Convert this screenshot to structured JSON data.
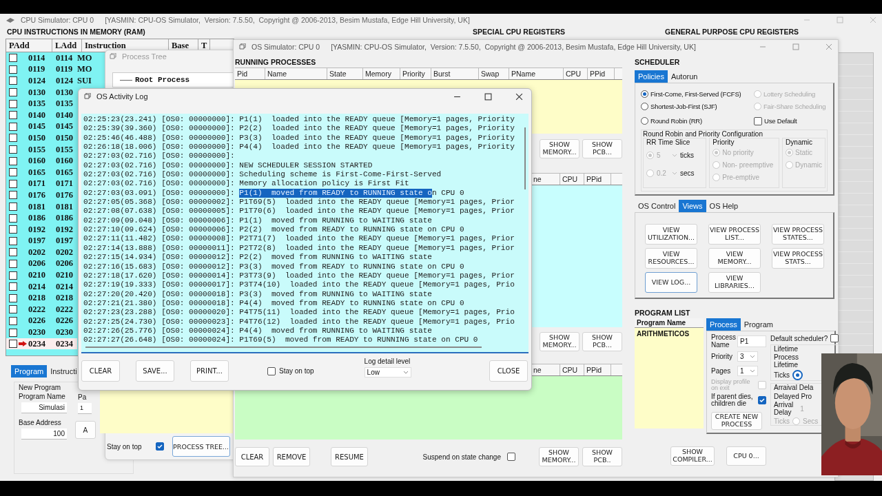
{
  "cpu_window": {
    "title": "CPU Simulator: CPU 0",
    "subtitle": "[YASMIN: CPU-OS Simulator,  Version: 7.5.50,  Copyright @ 2006-2013, Besim Mustafa, Edge Hill University, UK]",
    "ram_heading": "CPU INSTRUCTIONS IN MEMORY (RAM)",
    "special_heading": "SPECIAL CPU REGISTERS",
    "general_heading": "GENERAL PURPOSE CPU REGISTERS",
    "columns": [
      "PAdd",
      "LAdd",
      "Instruction",
      "Base",
      "T"
    ],
    "rows": [
      {
        "padd": "0114",
        "ladd": "0114",
        "instruction": "MO",
        "checked": false,
        "current": false
      },
      {
        "padd": "0119",
        "ladd": "0119",
        "instruction": "MO",
        "checked": false,
        "current": false
      },
      {
        "padd": "0124",
        "ladd": "0124",
        "instruction": "SUI",
        "checked": false,
        "current": false
      },
      {
        "padd": "0130",
        "ladd": "0130",
        "checked": false,
        "current": false
      },
      {
        "padd": "0135",
        "ladd": "0135",
        "checked": false,
        "current": false
      },
      {
        "padd": "0140",
        "ladd": "0140",
        "checked": false,
        "current": false
      },
      {
        "padd": "0145",
        "ladd": "0145",
        "checked": false,
        "current": false
      },
      {
        "padd": "0150",
        "ladd": "0150",
        "checked": false,
        "current": false
      },
      {
        "padd": "0155",
        "ladd": "0155",
        "checked": false,
        "current": false
      },
      {
        "padd": "0160",
        "ladd": "0160",
        "checked": false,
        "current": false
      },
      {
        "padd": "0165",
        "ladd": "0165",
        "checked": false,
        "current": false
      },
      {
        "padd": "0171",
        "ladd": "0171",
        "checked": false,
        "current": false
      },
      {
        "padd": "0176",
        "ladd": "0176",
        "checked": false,
        "current": false
      },
      {
        "padd": "0181",
        "ladd": "0181",
        "checked": false,
        "current": false
      },
      {
        "padd": "0186",
        "ladd": "0186",
        "checked": false,
        "current": false
      },
      {
        "padd": "0192",
        "ladd": "0192",
        "checked": false,
        "current": false
      },
      {
        "padd": "0197",
        "ladd": "0197",
        "checked": false,
        "current": false
      },
      {
        "padd": "0202",
        "ladd": "0202",
        "checked": false,
        "current": false
      },
      {
        "padd": "0206",
        "ladd": "0206",
        "checked": false,
        "current": false
      },
      {
        "padd": "0210",
        "ladd": "0210",
        "checked": false,
        "current": false
      },
      {
        "padd": "0214",
        "ladd": "0214",
        "checked": false,
        "current": false
      },
      {
        "padd": "0218",
        "ladd": "0218",
        "checked": false,
        "current": false
      },
      {
        "padd": "0222",
        "ladd": "0222",
        "checked": false,
        "current": false
      },
      {
        "padd": "0226",
        "ladd": "0226",
        "checked": false,
        "current": false
      },
      {
        "padd": "0230",
        "ladd": "0230",
        "checked": false,
        "current": false
      },
      {
        "padd": "0234",
        "ladd": "0234",
        "checked": false,
        "current": true
      }
    ],
    "tabs": [
      {
        "label": "Program",
        "selected": true
      },
      {
        "label": "Instructi",
        "selected": false
      }
    ],
    "new_program": {
      "title": "New Program",
      "name_label": "Program Name",
      "name": "Simulasi",
      "pages_label": "Pa",
      "pages": "1",
      "base_label": "Base Address",
      "base": "100",
      "button": "A"
    }
  },
  "process_tree": {
    "title": "Process Tree",
    "root": "Root Process",
    "stay_on_top": {
      "label": "Stay on top",
      "checked": true
    },
    "button": "PROCESS TREE..."
  },
  "os_window": {
    "title": "OS Simulator: CPU 0",
    "subtitle": "[YASMIN: CPU-OS Simulator,  Version: 7.5.50,  Copyright @ 2006-2013, Besim Mustafa, Edge Hill University, UK]",
    "running_heading": "RUNNING PROCESSES",
    "running_columns": [
      "Pid",
      "Name",
      "State",
      "Memory",
      "Priority",
      "Burst",
      "Swap",
      "PName",
      "CPU",
      "PPid"
    ],
    "buttons_1": [
      "SHOW\nMEMORY...",
      "SHOW\nPCB..."
    ],
    "table_2_columns": [
      "ne",
      "CPU",
      "PPid"
    ],
    "buttons_2": [
      "SHOW\nMEMORY...",
      "SHOW\nPCB..."
    ],
    "table_3_columns": [
      "ne",
      "CPU",
      "PPid"
    ],
    "actions": [
      "CLEAR",
      "REMOVE",
      "RESUME"
    ],
    "suspend": {
      "label": "Suspend on state change",
      "checked": false
    },
    "buttons_3": [
      "SHOW\nMEMORY...",
      "SHOW\nPCB.."
    ]
  },
  "scheduler": {
    "heading": "SCHEDULER",
    "tabs": [
      {
        "label": "Policies",
        "selected": true
      },
      {
        "label": "Autorun",
        "selected": false
      }
    ],
    "policies": [
      {
        "label": "First-Come, First-Served (FCFS)",
        "selected": true,
        "disabled": false
      },
      {
        "label": "Shortest-Job-First (SJF)",
        "selected": false,
        "disabled": false
      },
      {
        "label": "Round Robin (RR)",
        "selected": false,
        "disabled": false
      },
      {
        "label": "Lottery Scheduling",
        "selected": false,
        "disabled": true
      },
      {
        "label": "Fair-Share Scheduling",
        "selected": false,
        "disabled": true
      }
    ],
    "use_default": {
      "label": "Use Default",
      "checked": false
    },
    "config_title": "Round Robin and Priority Configuration",
    "time_slice": {
      "title": "RR Time Slice",
      "options": [
        {
          "value": "5",
          "unit": "ticks",
          "selected": true
        },
        {
          "value": "0.2",
          "unit": "secs",
          "selected": false
        }
      ]
    },
    "priority": {
      "title": "Priority",
      "options": [
        {
          "label": "No priority",
          "selected": true
        },
        {
          "label": "Non- preemptive",
          "selected": false
        },
        {
          "label": "Pre-emptive",
          "selected": false
        }
      ]
    },
    "dynamic": {
      "title": "Dynamic",
      "options": [
        {
          "label": "Static",
          "selected": true
        },
        {
          "label": "Dynamic",
          "selected": false
        }
      ]
    }
  },
  "os_tabs": [
    {
      "label": "OS Control",
      "selected": false
    },
    {
      "label": "Views",
      "selected": true
    },
    {
      "label": "OS Help",
      "selected": false
    }
  ],
  "view_buttons": [
    {
      "label": "VIEW\nUTILIZATION...",
      "focused": false
    },
    {
      "label": "VIEW PROCESS\nLIST...",
      "focused": false
    },
    {
      "label": "VIEW PROCESS\nSTATES...",
      "focused": false
    },
    {
      "label": "VIEW\nRESOURCES...",
      "focused": false
    },
    {
      "label": "VIEW\nMEMORY...",
      "focused": false
    },
    {
      "label": "VIEW PROCESS\nSTATS...",
      "focused": false
    },
    {
      "label": "VIEW LOG...",
      "focused": true
    },
    {
      "label": "VIEW\nLIBRARIES...",
      "focused": false
    }
  ],
  "program_list": {
    "heading": "PROGRAM LIST",
    "column": "Program Name",
    "items": [
      "ARITHMETICOS"
    ]
  },
  "process_tabs": [
    {
      "label": "Process",
      "selected": true
    },
    {
      "label": "Program",
      "selected": false
    }
  ],
  "process_form": {
    "name_label": "Process\nName",
    "name": "P1",
    "default_scheduler": {
      "label": "Default scheduler?",
      "checked": false
    },
    "priority_label": "Priority",
    "priority": "3",
    "pages_label": "Pages",
    "pages": "1",
    "lifetime": {
      "title": "Lifetime",
      "label": "Process\nLifetime",
      "ticks_label": "Ticks",
      "ticks_selected": true
    },
    "display_profile": {
      "label": "Display profile\non exit",
      "checked": false,
      "disabled": true
    },
    "parent_dies": {
      "label": "If parent dies,\nchildren die",
      "checked": true,
      "disabled": false
    },
    "arrival": {
      "title": "Arraival Dela",
      "delayed": "Delayed Pro",
      "label": "Arrival\nDelay",
      "value": "1",
      "ticks": "Ticks",
      "secs": "Secs",
      "secs_selected": false
    },
    "create_button": "CREATE NEW\nPROCESS"
  },
  "bottom_buttons": [
    "SHOW\nCOMPILER...",
    "CPU 0..."
  ],
  "activity_log": {
    "title": "OS Activity Log",
    "lines": [
      {
        "text": "02:25:23(23.241) [OS0: 00000000]: P1(1)  loaded into the READY queue [Memory=1 pages, Priority"
      },
      {
        "text": "02:25:39(39.360) [OS0: 00000000]: P2(2)  loaded into the READY queue [Memory=1 pages, Priority"
      },
      {
        "text": "02:25:46(46.488) [OS0: 00000000]: P3(3)  loaded into the READY queue [Memory=1 pages, Priority"
      },
      {
        "text": "02:26:18(18.006) [OS0: 00000000]: P4(4)  loaded into the READY queue [Memory=1 pages, Priority"
      },
      {
        "text": "02:27:03(02.716) [OS0: 00000000]:"
      },
      {
        "text": "02:27:03(02.716) [OS0: 00000000]: NEW SCHEDULER SESSION STARTED"
      },
      {
        "text": "02:27:03(02.716) [OS0: 00000000]: Scheduling scheme is First-Come-First-Served"
      },
      {
        "text": "02:27:03(02.716) [OS0: 00000000]: Memory allocation policy is First Fit"
      },
      {
        "text": "02:27:03(03.091) [OS0: 00000000]: ",
        "selection": "P1(1)  moved from READY to RUNNING state o",
        "after": "n CPU 0"
      },
      {
        "text": "02:27:05(05.368) [OS0: 00000002]: P1T69(5)  loaded into the READY queue [Memory=1 pages, Prior"
      },
      {
        "text": "02:27:08(07.638) [OS0: 00000005]: P1T70(6)  loaded into the READY queue [Memory=1 pages, Prior"
      },
      {
        "text": "02:27:09(09.048) [OS0: 00000006]: P1(1)  moved from RUNNING to WAITING state"
      },
      {
        "text": "02:27:10(09.624) [OS0: 00000006]: P2(2)  moved from READY to RUNNING state on CPU 0"
      },
      {
        "text": "02:27:11(11.482) [OS0: 00000008]: P2T71(7)  loaded into the READY queue [Memory=1 pages, Prior"
      },
      {
        "text": "02:27:14(13.888) [OS0: 00000011]: P2T72(8)  loaded into the READY queue [Memory=1 pages, Prior"
      },
      {
        "text": "02:27:15(14.934) [OS0: 00000012]: P2(2)  moved from RUNNING to WAITING state"
      },
      {
        "text": "02:27:16(15.683) [OS0: 00000012]: P3(3)  moved from READY to RUNNING state on CPU 0"
      },
      {
        "text": "02:27:18(17.620) [OS0: 00000014]: P3T73(9)  loaded into the READY queue [Memory=1 pages, Prior"
      },
      {
        "text": "02:27:19(19.333) [OS0: 00000017]: P3T74(10)  loaded into the READY queue [Memory=1 pages, Prio"
      },
      {
        "text": "02:27:20(20.420) [OS0: 00000018]: P3(3)  moved from RUNNING to WAITING state"
      },
      {
        "text": "02:27:21(21.380) [OS0: 00000018]: P4(4)  moved from READY to RUNNING state on CPU 0"
      },
      {
        "text": "02:27:23(23.288) [OS0: 00000020]: P4T75(11)  loaded into the READY queue [Memory=1 pages, Prio"
      },
      {
        "text": "02:27:25(24.730) [OS0: 00000023]: P4T76(12)  loaded into the READY queue [Memory=1 pages, Prio"
      },
      {
        "text": "02:27:26(25.776) [OS0: 00000024]: P4(4)  moved from RUNNING to WAITING state"
      },
      {
        "text": "02:27:27(26.648) [OS0: 00000024]: P1T69(5)  moved from READY to RUNNING state on CPU 0"
      }
    ],
    "buttons": [
      "CLEAR",
      "SAVE...",
      "PRINT..."
    ],
    "stay_on_top": {
      "label": "Stay on top",
      "checked": false
    },
    "detail_label": "Log detail level",
    "detail": "Low",
    "close": "CLOSE"
  }
}
